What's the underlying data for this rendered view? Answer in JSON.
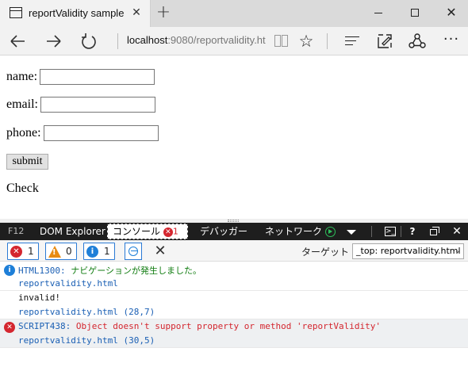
{
  "browser": {
    "tab_title": "reportValidity sample",
    "tab_close": "✕",
    "new_tab": "+",
    "window_close": "✕",
    "address_host": "localhost",
    "address_path": ":9080/reportvalidity.ht",
    "icons": [
      "back-arrow-icon",
      "forward-arrow-icon",
      "refresh-icon",
      "reading-view-icon",
      "favorite-star-icon",
      "hub-icon",
      "web-note-icon",
      "share-icon",
      "more-icon"
    ]
  },
  "page": {
    "name_label": "name:",
    "name_value": "",
    "email_label": "email:",
    "email_value": "",
    "phone_label": "phone:",
    "phone_value": "",
    "submit_label": "submit",
    "check_text": "Check"
  },
  "devtools": {
    "tabs": {
      "f12": "F12",
      "dom_explorer": "DOM Explorer",
      "console": "コンソール",
      "console_error_count": "1",
      "debugger": "デバッガー",
      "network": "ネットワーク"
    },
    "toolbar": {
      "errors_count": "1",
      "warnings_count": "0",
      "info_count": "1",
      "target_label": "ターゲット",
      "target_value": "_top: reportvalidity.html"
    },
    "messages": [
      {
        "type": "info",
        "code": "HTML1300:",
        "text": "ナビゲーションが発生しました。",
        "source": "reportvalidity.html"
      },
      {
        "type": "log",
        "text": "invalid!",
        "source": "reportvalidity.html (28,7)"
      },
      {
        "type": "error",
        "code": "SCRIPT438:",
        "text": "Object doesn't support property or method 'reportValidity'",
        "source": "reportvalidity.html (30,5)"
      }
    ],
    "colors": {
      "error": "#d4262f",
      "warning": "#e88b12",
      "info": "#1e7fd8",
      "link": "#1a5fb4",
      "success": "#107c10"
    }
  }
}
